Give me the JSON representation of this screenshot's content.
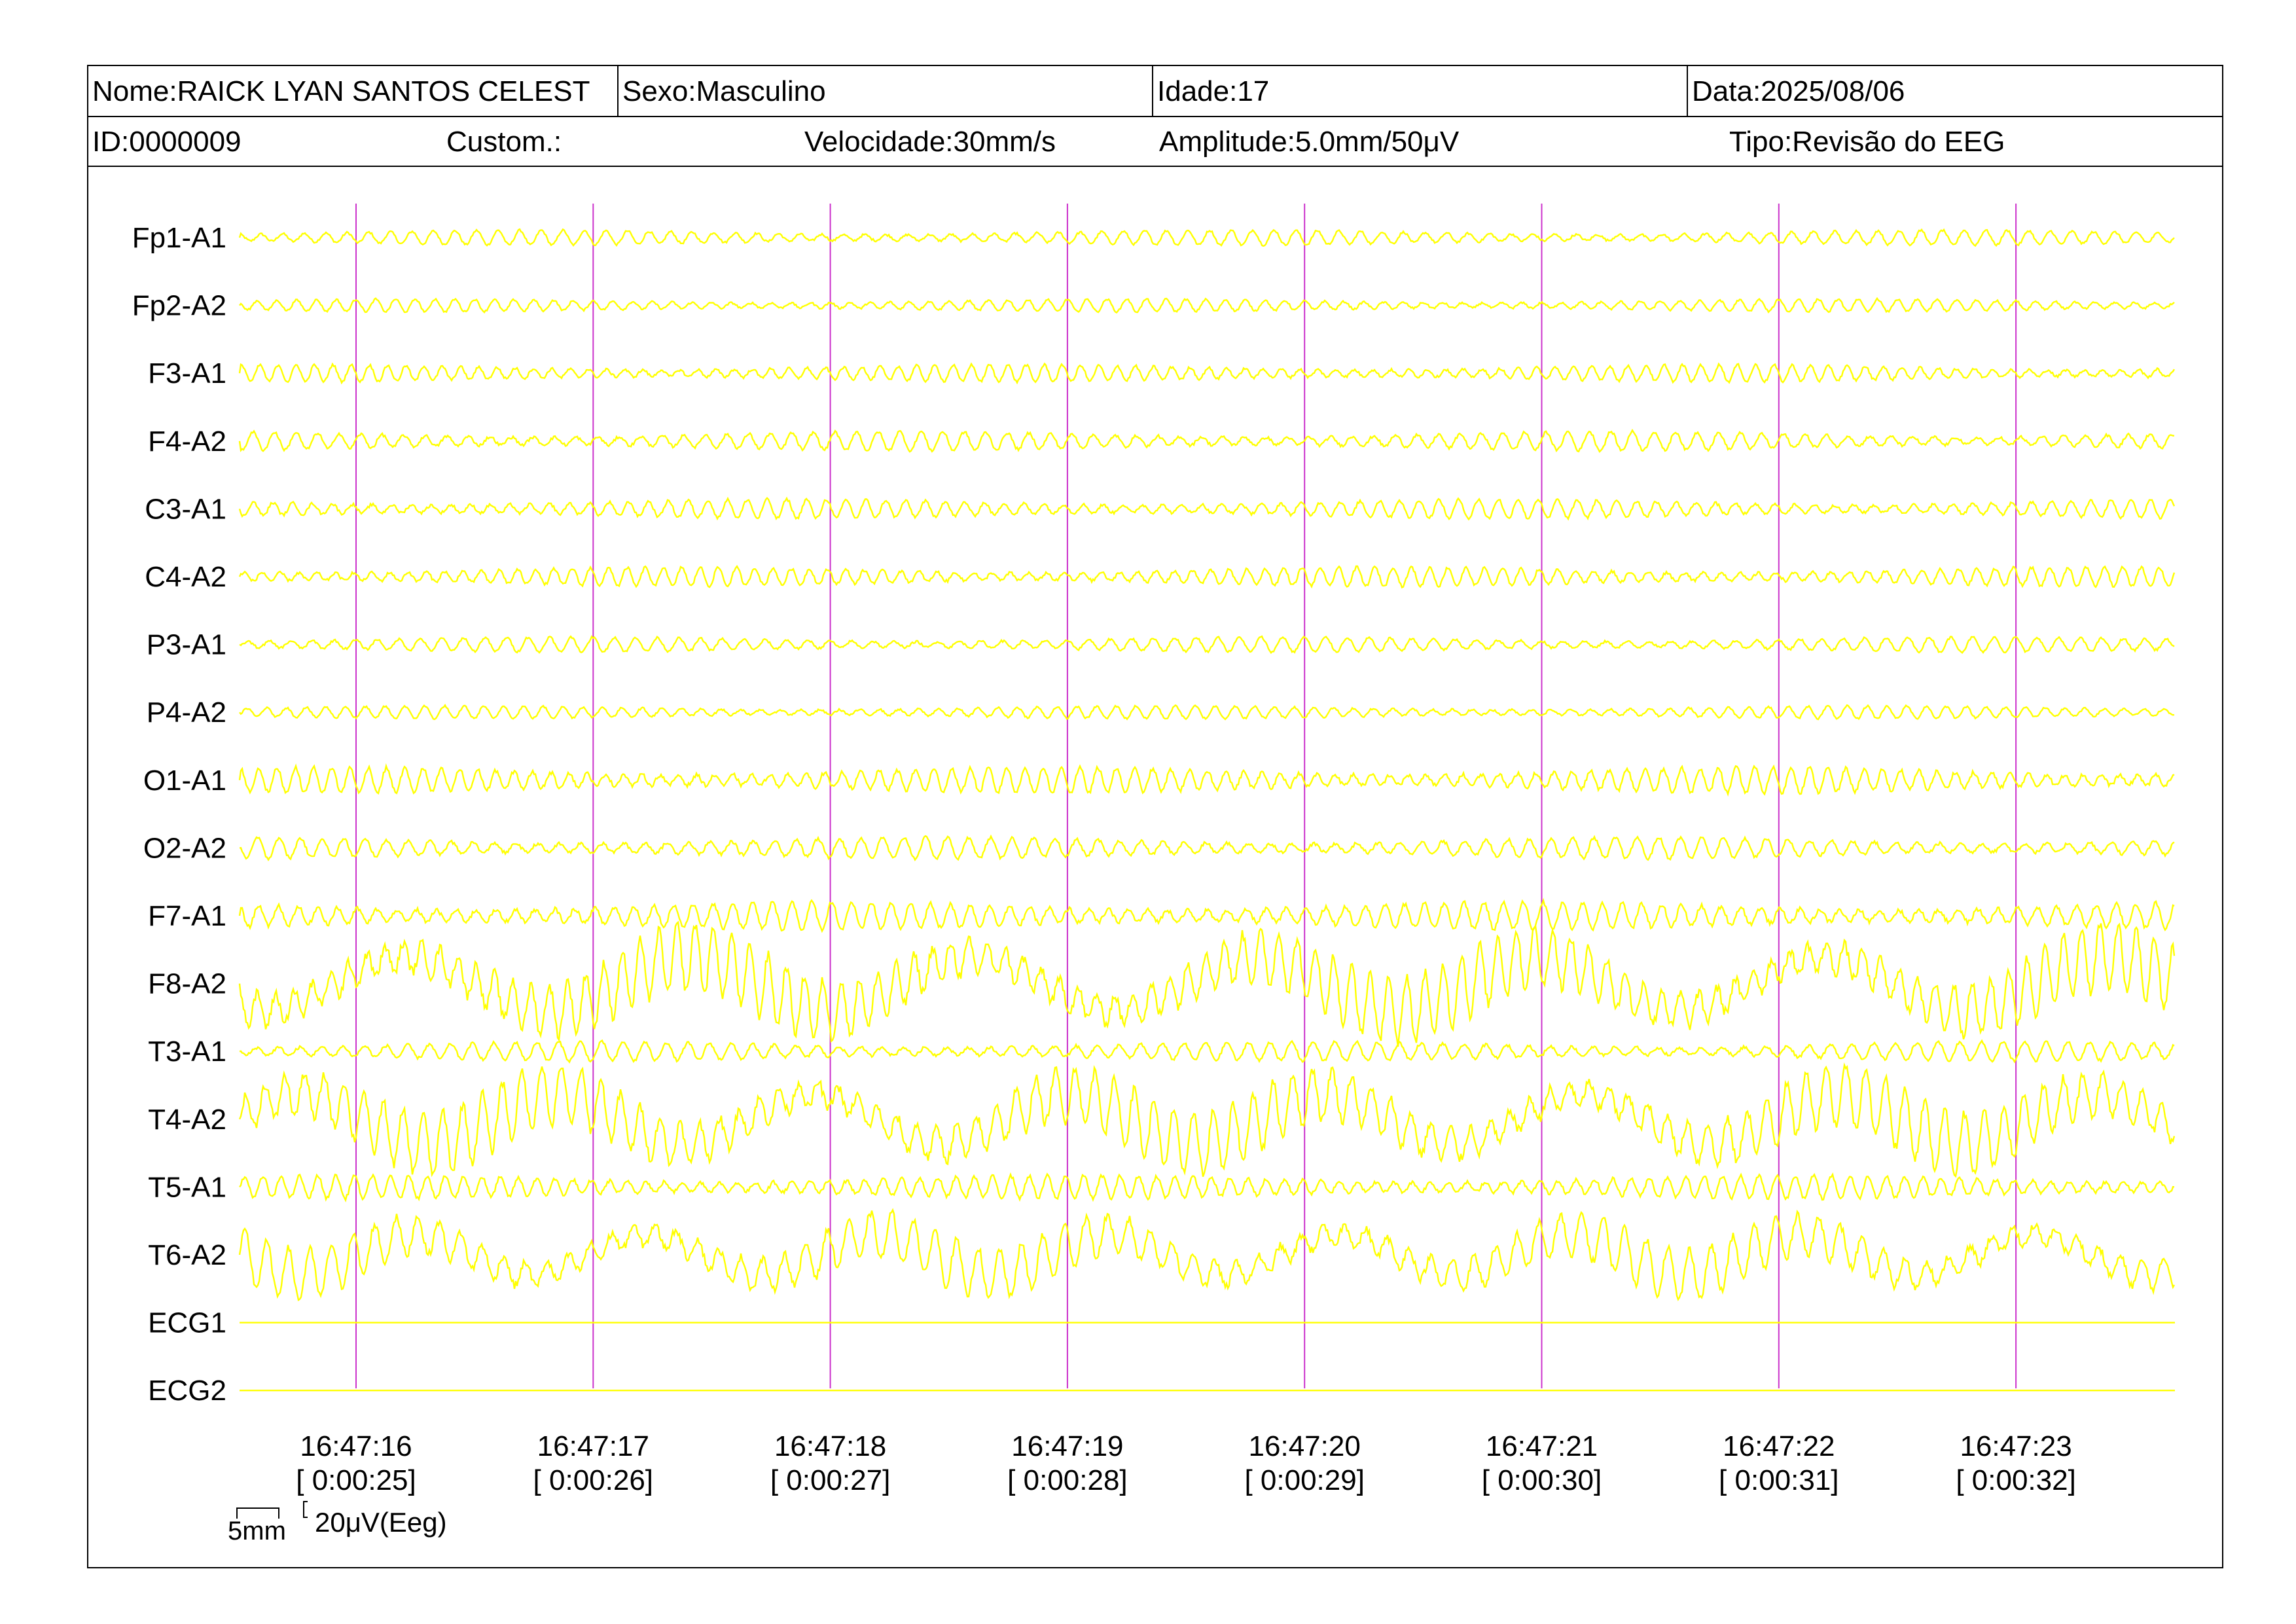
{
  "header": {
    "nome": "Nome:RAICK LYAN SANTOS CELEST",
    "sexo": "Sexo:Masculino",
    "idade": "Idade:17",
    "data": "Data:2025/08/06",
    "id": "ID:0000009",
    "custom": "Custom.:",
    "velocidade": "Velocidade:30mm/s",
    "amplitude": "Amplitude:5.0mm/50μV",
    "tipo": "Tipo:Revisão do EEG"
  },
  "scale_bar": {
    "time_label": "5mm",
    "amp_label": "20μV(Eeg)"
  },
  "colors": {
    "trace": "#ffff00",
    "marker": "#cc33cc",
    "text": "#000000",
    "border": "#000000"
  },
  "chart_data": {
    "type": "line",
    "title": "",
    "channels": [
      "Fp1-A1",
      "Fp2-A2",
      "F3-A1",
      "F4-A2",
      "C3-A1",
      "C4-A2",
      "P3-A1",
      "P4-A2",
      "O1-A1",
      "O2-A2",
      "F7-A1",
      "F8-A2",
      "T3-A1",
      "T4-A2",
      "T5-A1",
      "T6-A2",
      "ECG1",
      "ECG2"
    ],
    "relative_amplitude": [
      0.35,
      0.3,
      0.4,
      0.45,
      0.45,
      0.45,
      0.35,
      0.3,
      0.6,
      0.5,
      0.65,
      1.6,
      0.45,
      1.5,
      0.55,
      1.2,
      0,
      0
    ],
    "time_markers": [
      {
        "clock": "16:47:16",
        "elapsed": "[ 0:00:25]"
      },
      {
        "clock": "16:47:17",
        "elapsed": "[ 0:00:26]"
      },
      {
        "clock": "16:47:18",
        "elapsed": "[ 0:00:27]"
      },
      {
        "clock": "16:47:19",
        "elapsed": "[ 0:00:28]"
      },
      {
        "clock": "16:47:20",
        "elapsed": "[ 0:00:29]"
      },
      {
        "clock": "16:47:21",
        "elapsed": "[ 0:00:30]"
      },
      {
        "clock": "16:47:22",
        "elapsed": "[ 0:00:31]"
      },
      {
        "clock": "16:47:23",
        "elapsed": "[ 0:00:32]"
      }
    ],
    "x_range_seconds": [
      24.5,
      32.7
    ],
    "legend": "none",
    "grid": false
  }
}
